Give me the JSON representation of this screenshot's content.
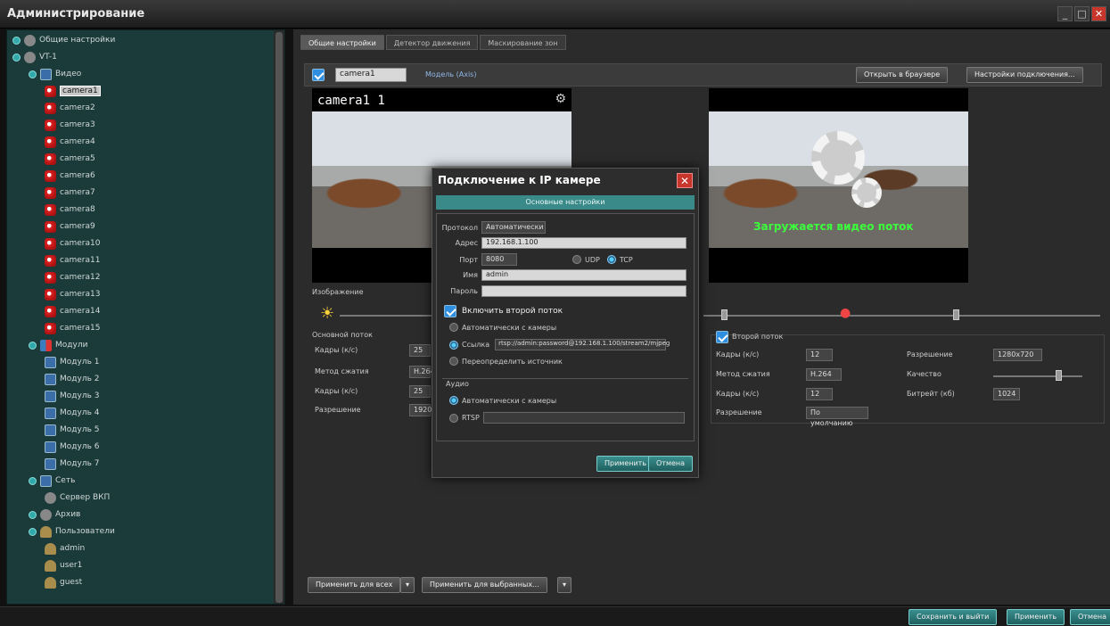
{
  "window": {
    "title": "Администрирование",
    "minimize": "_",
    "maximize": "□",
    "close": "✕"
  },
  "sidebar": {
    "items": [
      {
        "label": "Общие настройки",
        "icon": "tools-icon",
        "depth": 0
      },
      {
        "label": "VT-1",
        "icon": "server-icon",
        "depth": 0
      },
      {
        "label": "Видео",
        "icon": "monitor-icon",
        "depth": 1
      },
      {
        "label": "camera1",
        "icon": "camera-icon",
        "depth": 2,
        "selected": true
      },
      {
        "label": "camera2",
        "icon": "camera-icon",
        "depth": 2
      },
      {
        "label": "camera3",
        "icon": "camera-icon",
        "depth": 2
      },
      {
        "label": "camera4",
        "icon": "camera-icon",
        "depth": 2
      },
      {
        "label": "camera5",
        "icon": "camera-icon",
        "depth": 2
      },
      {
        "label": "camera6",
        "icon": "camera-icon",
        "depth": 2
      },
      {
        "label": "camera7",
        "icon": "camera-icon",
        "depth": 2
      },
      {
        "label": "camera8",
        "icon": "camera-icon",
        "depth": 2
      },
      {
        "label": "camera9",
        "icon": "camera-icon",
        "depth": 2
      },
      {
        "label": "camera10",
        "icon": "camera-icon",
        "depth": 2
      },
      {
        "label": "camera11",
        "icon": "camera-icon",
        "depth": 2
      },
      {
        "label": "camera12",
        "icon": "camera-icon",
        "depth": 2
      },
      {
        "label": "camera13",
        "icon": "camera-icon",
        "depth": 2
      },
      {
        "label": "camera14",
        "icon": "camera-icon",
        "depth": 2
      },
      {
        "label": "camera15",
        "icon": "camera-icon",
        "depth": 2
      },
      {
        "label": "Модули",
        "icon": "modules-icon",
        "depth": 1
      },
      {
        "label": "Модуль 1",
        "icon": "module-icon",
        "depth": 2
      },
      {
        "label": "Модуль 2",
        "icon": "module-icon",
        "depth": 2
      },
      {
        "label": "Модуль 3",
        "icon": "module-icon",
        "depth": 2
      },
      {
        "label": "Модуль 4",
        "icon": "module-icon",
        "depth": 2
      },
      {
        "label": "Модуль 5",
        "icon": "module-icon",
        "depth": 2
      },
      {
        "label": "Модуль 6",
        "icon": "module-icon",
        "depth": 2
      },
      {
        "label": "Модуль 7",
        "icon": "module-icon",
        "depth": 2
      },
      {
        "label": "Сеть",
        "icon": "network-icon",
        "depth": 1
      },
      {
        "label": "Сервер ВКП",
        "icon": "globe-icon",
        "depth": 2
      },
      {
        "label": "Архив",
        "icon": "archive-icon",
        "depth": 1
      },
      {
        "label": "Пользователи",
        "icon": "users-icon",
        "depth": 1
      },
      {
        "label": "admin",
        "icon": "user-icon",
        "depth": 2
      },
      {
        "label": "user1",
        "icon": "user-icon",
        "depth": 2
      },
      {
        "label": "guest",
        "icon": "user-icon",
        "depth": 2
      }
    ]
  },
  "tabs": [
    "Общие настройки",
    "Детектор движения",
    "Маскирование зон"
  ],
  "toolbar": {
    "camera_name": "camera1",
    "model_link": "Модель (Axis)",
    "open_browser": "Открыть в браузере",
    "setup_connection": "Настройки подключения..."
  },
  "preview_left": {
    "label": "camera1 1"
  },
  "preview_right": {
    "overlay": "Загружается видео поток"
  },
  "left_panel": {
    "image_header": "Изображение",
    "settings_header": "Основной поток",
    "rows": [
      {
        "k": "Кадры (к/с)",
        "v": "25"
      },
      {
        "k": "Метод сжатия",
        "v": "H.264"
      },
      {
        "k": "Кадры (к/с)",
        "v": "25"
      },
      {
        "k": "Разрешение",
        "v": "1920x1080"
      }
    ]
  },
  "right_panel": {
    "second_stream": "Второй поток",
    "rows": [
      {
        "k": "Кадры (к/с)",
        "v": "12"
      },
      {
        "k": "Метод сжатия",
        "v": "H.264"
      },
      {
        "k": "Кадры (к/с)",
        "v": "12"
      },
      {
        "k": "Разрешение",
        "v": "По умолчанию"
      }
    ],
    "right_rows": [
      {
        "k": "Разрешение",
        "v": "1280x720"
      },
      {
        "k": "Качество",
        "v": ""
      },
      {
        "k": "Битрейт (кб)",
        "v": "1024"
      }
    ]
  },
  "bottom_buttons": {
    "apply_all": "Применить для всех",
    "apply_selected": "Применить для выбранных..."
  },
  "footer_buttons": {
    "save_close": "Сохранить и выйти",
    "apply": "Применить",
    "cancel": "Отмена"
  },
  "dialog": {
    "title": "Подключение к IP камере",
    "tab": "Основные настройки",
    "protocol_label": "Протокол",
    "protocol_value": "Автоматически",
    "address_label": "Адрес",
    "address_value": "192.168.1.100",
    "port_label": "Порт",
    "port_value": "8080",
    "udp": "UDP",
    "tcp": "TCP",
    "name_label": "Имя",
    "name_value": "admin",
    "password_label": "Пароль",
    "password_value": "",
    "enable_second": "Включить второй поток",
    "auto_second": "Автоматически с камеры",
    "url_option": "Ссылка",
    "url_value": "rtsp://admin:password@192.168.1.100/stream2/mjpeg",
    "redetect": "Переопределить источник",
    "audio_header": "Аудио",
    "audio_auto": "Автоматически с камеры",
    "audio_rtsp": "RTSP",
    "connect": "Применить",
    "cancel": "Отмена"
  }
}
